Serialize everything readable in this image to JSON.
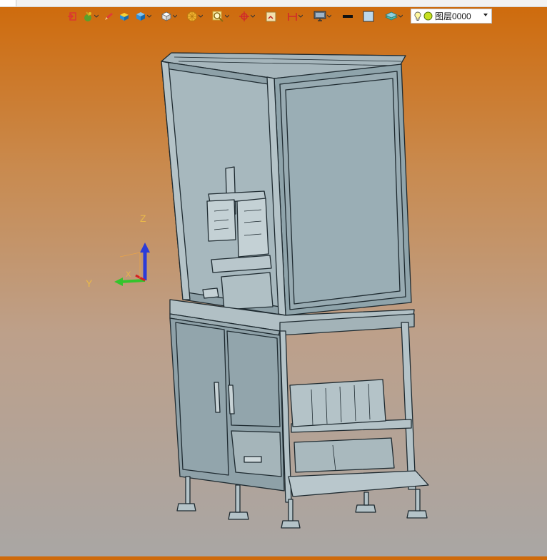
{
  "toolbar": {
    "buttons": [
      {
        "name": "exit-sketch-icon"
      },
      {
        "name": "sketch-paint-icon",
        "dropdown": true
      },
      {
        "name": "pencil-icon"
      },
      {
        "name": "solid-shaded-icon"
      },
      {
        "name": "blue-cube-icon",
        "dropdown": true
      },
      {
        "name": "white-cube-view-icon",
        "dropdown": true
      },
      {
        "name": "display-mode-icon",
        "dropdown": true
      },
      {
        "name": "zoom-magnifier-icon",
        "dropdown": true
      },
      {
        "name": "rotate-origin-icon",
        "dropdown": true
      },
      {
        "name": "section-view-icon"
      },
      {
        "name": "measure-bracket-icon",
        "dropdown": true
      },
      {
        "name": "monitor-display-icon",
        "dropdown": true
      },
      {
        "name": "line-style-icon"
      },
      {
        "name": "fill-color-icon"
      },
      {
        "name": "layer-stack-icon",
        "dropdown": true
      }
    ]
  },
  "layer": {
    "label": "图层0000",
    "icons": [
      "lightbulb-icon",
      "layer-color-dot-icon"
    ]
  },
  "triad": {
    "x_label": "X",
    "y_label": "Y",
    "z_label": "Z"
  },
  "colors": {
    "model_fill": "#93a6ad",
    "model_edge": "#1e2a30",
    "axis_z": "#2b3cd8",
    "axis_y": "#34c42c",
    "axis_x": "#d42020"
  }
}
